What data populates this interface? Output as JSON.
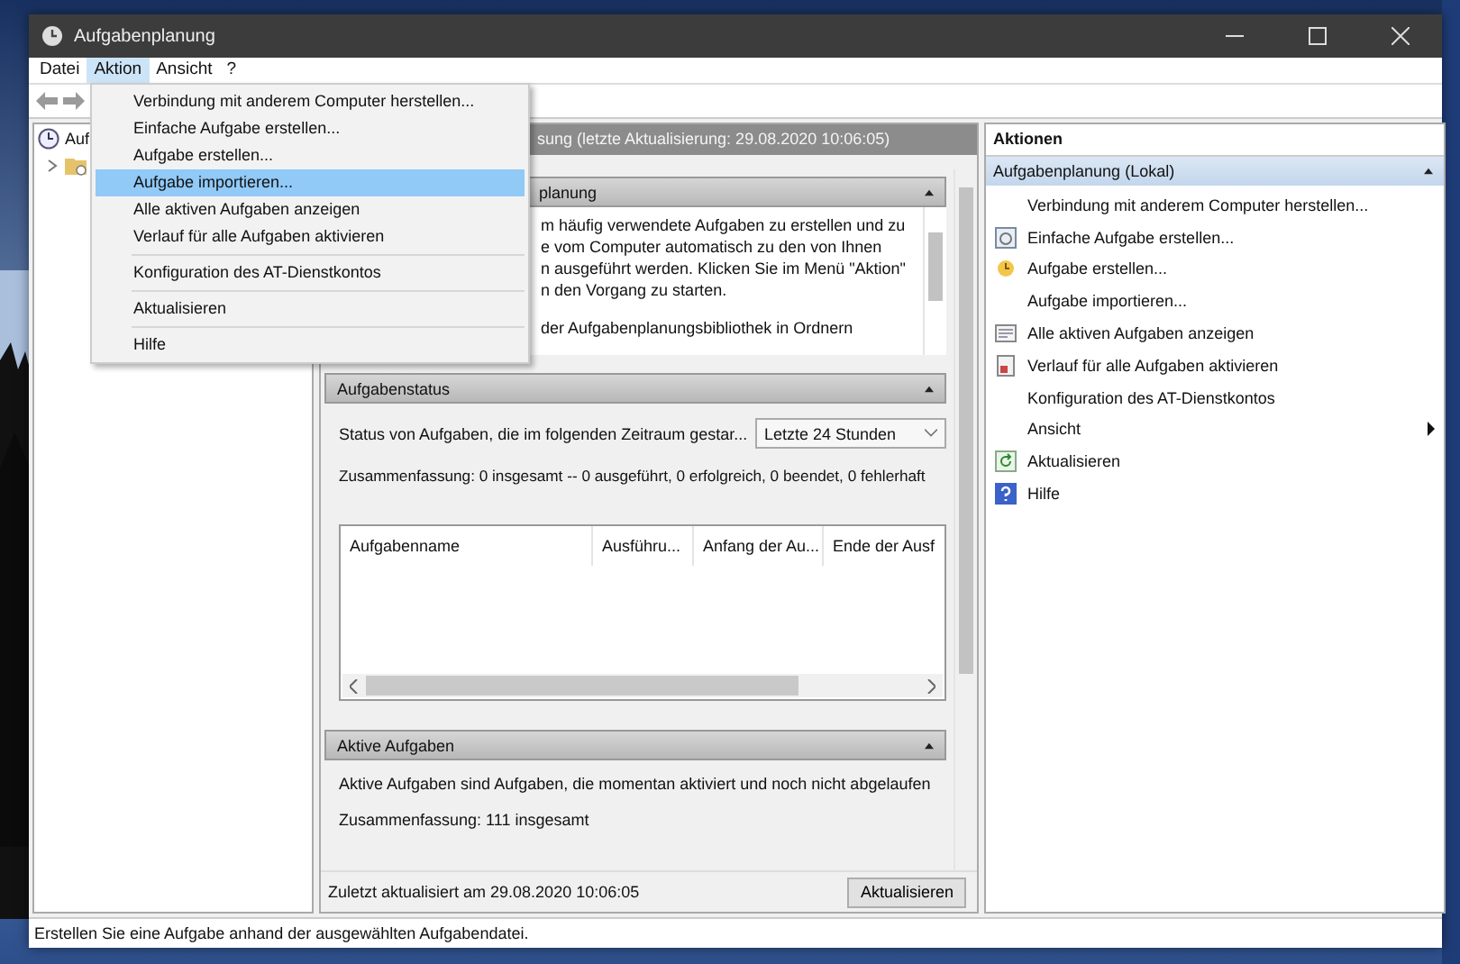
{
  "window": {
    "title": "Aufgabenplanung"
  },
  "menu_bar": [
    {
      "label": "Datei",
      "selected": false
    },
    {
      "label": "Aktion",
      "selected": true
    },
    {
      "label": "Ansicht",
      "selected": false
    },
    {
      "label": "?",
      "selected": false
    }
  ],
  "open_menu": {
    "groups": [
      [
        {
          "label": "Verbindung mit anderem Computer herstellen...",
          "selected": false
        },
        {
          "label": "Einfache Aufgabe erstellen...",
          "selected": false
        },
        {
          "label": "Aufgabe erstellen...",
          "selected": false
        },
        {
          "label": "Aufgabe importieren...",
          "selected": true
        },
        {
          "label": "Alle aktiven Aufgaben anzeigen",
          "selected": false
        },
        {
          "label": "Verlauf für alle Aufgaben aktivieren",
          "selected": false
        }
      ],
      [
        {
          "label": "Konfiguration des AT-Dienstkontos",
          "selected": false
        }
      ],
      [
        {
          "label": "Aktualisieren",
          "selected": false
        }
      ],
      [
        {
          "label": "Hilfe",
          "selected": false
        }
      ]
    ]
  },
  "tree": {
    "label": "Auf",
    "child_expanded": false
  },
  "summary_header": "sung (letzte Aktualisierung: 29.08.2020 10:06:05)",
  "overview": {
    "title": "planung",
    "lines": [
      "m häufig verwendete Aufgaben zu erstellen und zu",
      "e vom Computer automatisch zu den von Ihnen",
      "n ausgeführt werden. Klicken Sie im Menü \"Aktion\"",
      "n den Vorgang zu starten.",
      "der Aufgabenplanungsbibliothek in Ordnern"
    ]
  },
  "task_status": {
    "title": "Aufgabenstatus",
    "period_label": "Status von Aufgaben, die im folgenden Zeitraum gestar...",
    "period": "Letzte 24 Stunden",
    "summary": "Zusammenfassung: 0 insgesamt -- 0 ausgeführt, 0 erfolgreich, 0 beendet, 0 fehlerhaft",
    "table": {
      "columns": [
        "Aufgabenname",
        "Ausführu...",
        "Anfang der Au...",
        "Ende der Ausf"
      ]
    }
  },
  "active_tasks": {
    "title": "Aktive Aufgaben",
    "description": "Aktive Aufgaben sind Aufgaben, die momentan aktiviert und noch nicht abgelaufen",
    "summary": "Zusammenfassung: 111 insgesamt"
  },
  "last_updated": "Zuletzt aktualisiert am 29.08.2020 10:06:05",
  "refresh_button": "Aktualisieren",
  "actions": {
    "title": "Aktionen",
    "group": "Aufgabenplanung (Lokal)",
    "items": [
      {
        "label": "Verbindung mit anderem Computer herstellen...",
        "kind": "plain",
        "submenu": false
      },
      {
        "label": "Einfache Aufgabe erstellen...",
        "kind": "wizard",
        "submenu": false
      },
      {
        "label": "Aufgabe erstellen...",
        "kind": "task",
        "submenu": false
      },
      {
        "label": "Aufgabe importieren...",
        "kind": "plain",
        "submenu": false
      },
      {
        "label": "Alle aktiven Aufgaben anzeigen",
        "kind": "list",
        "submenu": false
      },
      {
        "label": "Verlauf für alle Aufgaben aktivieren",
        "kind": "history",
        "submenu": false
      },
      {
        "label": "Konfiguration des AT-Dienstkontos",
        "kind": "plain",
        "submenu": false
      },
      {
        "label": "Ansicht",
        "kind": "plain",
        "submenu": true
      },
      {
        "label": "Aktualisieren",
        "kind": "refresh",
        "submenu": false
      },
      {
        "label": "Hilfe",
        "kind": "help",
        "submenu": false
      }
    ]
  },
  "status_bar": "Erstellen Sie eine Aufgabe anhand der ausgewählten Aufgabendatei."
}
